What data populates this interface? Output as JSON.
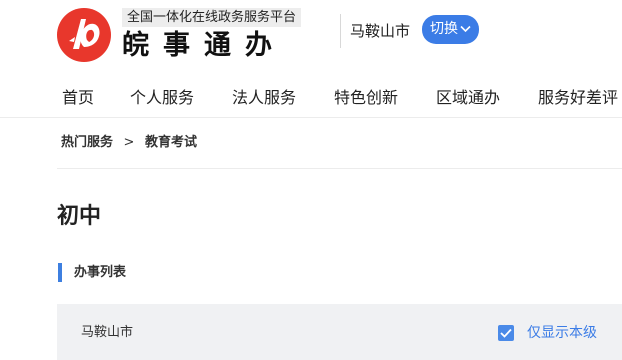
{
  "header": {
    "platform_tag": "全国一体化在线政务服务平台",
    "brand_name": "皖事通办",
    "logo_icon": "anhui-gov-service-logo-icon",
    "city": "马鞍山市",
    "switch_label": "切换",
    "switch_icon": "chevron-down-icon",
    "brand_color": "#e8372c",
    "accent_color": "#3b7ce6"
  },
  "nav": {
    "items": [
      "首页",
      "个人服务",
      "法人服务",
      "特色创新",
      "区域通办",
      "服务好差评"
    ]
  },
  "breadcrumb": {
    "items": [
      "热门服务",
      "教育考试"
    ],
    "separator": ">"
  },
  "page": {
    "title": "初中",
    "section_label": "办事列表"
  },
  "filter": {
    "region": "马鞍山市",
    "only_this_level_label": "仅显示本级",
    "only_this_level_checked": true
  }
}
